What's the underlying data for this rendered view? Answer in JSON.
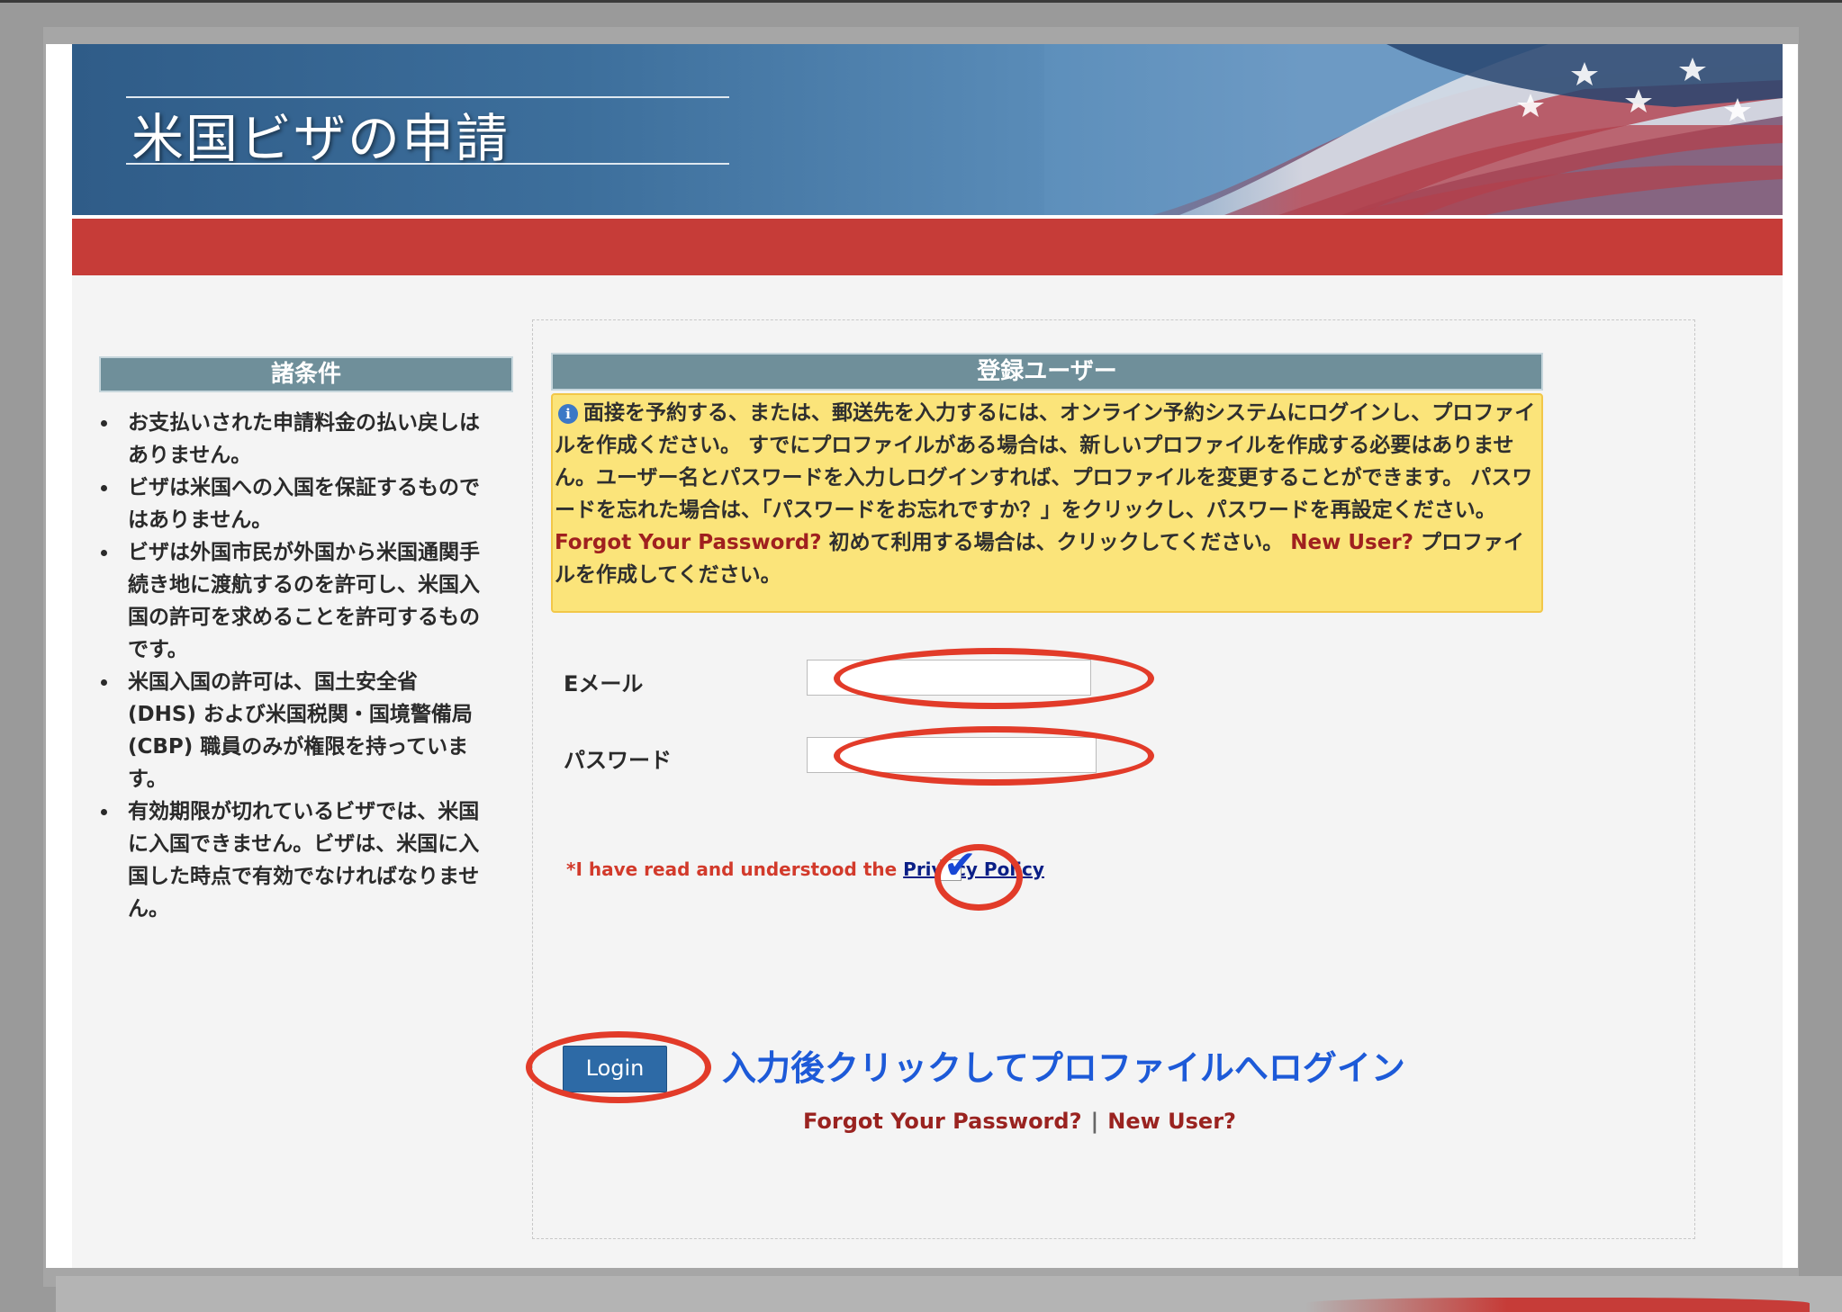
{
  "header": {
    "title": "米国ビザの申請"
  },
  "sidebar": {
    "heading": "諸条件",
    "items": [
      "お支払いされた申請料金の払い戻しはありません。",
      "ビザは米国への入国を保証するものではありません。",
      "ビザは外国市民が外国から米国通関手続き地に渡航するのを許可し、米国入国の許可を求めることを許可するものです。",
      "米国入国の許可は、国土安全省 (DHS) および米国税関・国境警備局 (CBP) 職員のみが権限を持っています。",
      "有効期限が切れているビザでは、米国に入国できません。ビザは、米国に入国した時点で有効でなければなりません。"
    ]
  },
  "main": {
    "heading": "登録ユーザー",
    "info": {
      "icon": "info-icon",
      "text1": "面接を予約する、または、郵送先を入力するには、オンライン予約システムにログインし、プロファイルを作成ください。 すでにプロファイルがある場合は、新しいプロファイルを作成する必要はありません。ユーザー名とパスワードを入力しログインすれば、プロファイルを変更することができます。 パスワードを忘れた場合は、「パスワードをお忘れですか？」をクリックし、パスワードを再設定ください。 ",
      "link1": "Forgot Your Password?",
      "text2": " 初めて利用する場合は、クリックしてください。 ",
      "link2": "New User?",
      "text3": " プロファイルを作成してください。"
    },
    "email_label": "Eメール",
    "email_value": "",
    "password_label": "パスワード",
    "password_value": "",
    "privacy_prefix": "*I have read and understood the ",
    "privacy_link": "Privacy Policy",
    "check_mark": "✔",
    "login_label": "Login",
    "annotation": "入力後クリックしてプロファイルへログイン",
    "forgot_link": "Forgot Your Password?",
    "separator": "|",
    "new_user_link": "New User?"
  },
  "colors": {
    "accent_red": "#c63c38",
    "section_header": "#6f8f9a",
    "info_bg": "#fbe47a",
    "annotation_blue": "#1d5ad8",
    "annotation_ellipse": "#e23b29"
  }
}
